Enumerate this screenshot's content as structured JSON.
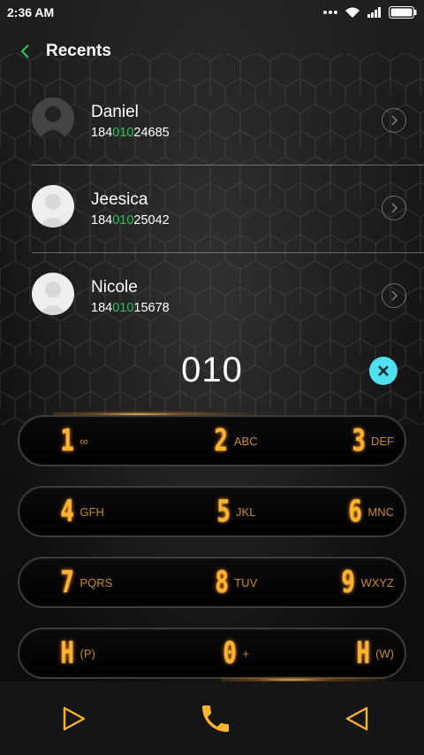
{
  "status_bar": {
    "time": "2:36 AM"
  },
  "header": {
    "title": "Recents"
  },
  "recents": [
    {
      "name": "Daniel",
      "number_prefix": "184",
      "number_match": "010",
      "number_suffix": "24685",
      "avatar": "dark"
    },
    {
      "name": "Jeesica",
      "number_prefix": "184",
      "number_match": "010",
      "number_suffix": "25042",
      "avatar": "light"
    },
    {
      "name": "Nicole",
      "number_prefix": "184",
      "number_match": "010",
      "number_suffix": "15678",
      "avatar": "light"
    }
  ],
  "dial": {
    "value": "010"
  },
  "keypad": [
    [
      {
        "digit": "1",
        "letters": "∞"
      },
      {
        "digit": "2",
        "letters": "ABC"
      },
      {
        "digit": "3",
        "letters": "DEF"
      }
    ],
    [
      {
        "digit": "4",
        "letters": "GFH"
      },
      {
        "digit": "5",
        "letters": "JKL"
      },
      {
        "digit": "6",
        "letters": "MNC"
      }
    ],
    [
      {
        "digit": "7",
        "letters": "PQRS"
      },
      {
        "digit": "8",
        "letters": "TUV"
      },
      {
        "digit": "9",
        "letters": "WXYZ"
      }
    ],
    [
      {
        "digit": "H",
        "letters": "(P)"
      },
      {
        "digit": "0",
        "letters": "+"
      },
      {
        "digit": "H",
        "letters": "(W)"
      }
    ]
  ],
  "colors": {
    "accent": "#ffb22e",
    "highlight": "#29c45c",
    "clear": "#4ee0ef"
  },
  "icons": {
    "back": "chevron-left-icon",
    "clear": "close-icon",
    "call": "phone-icon"
  }
}
